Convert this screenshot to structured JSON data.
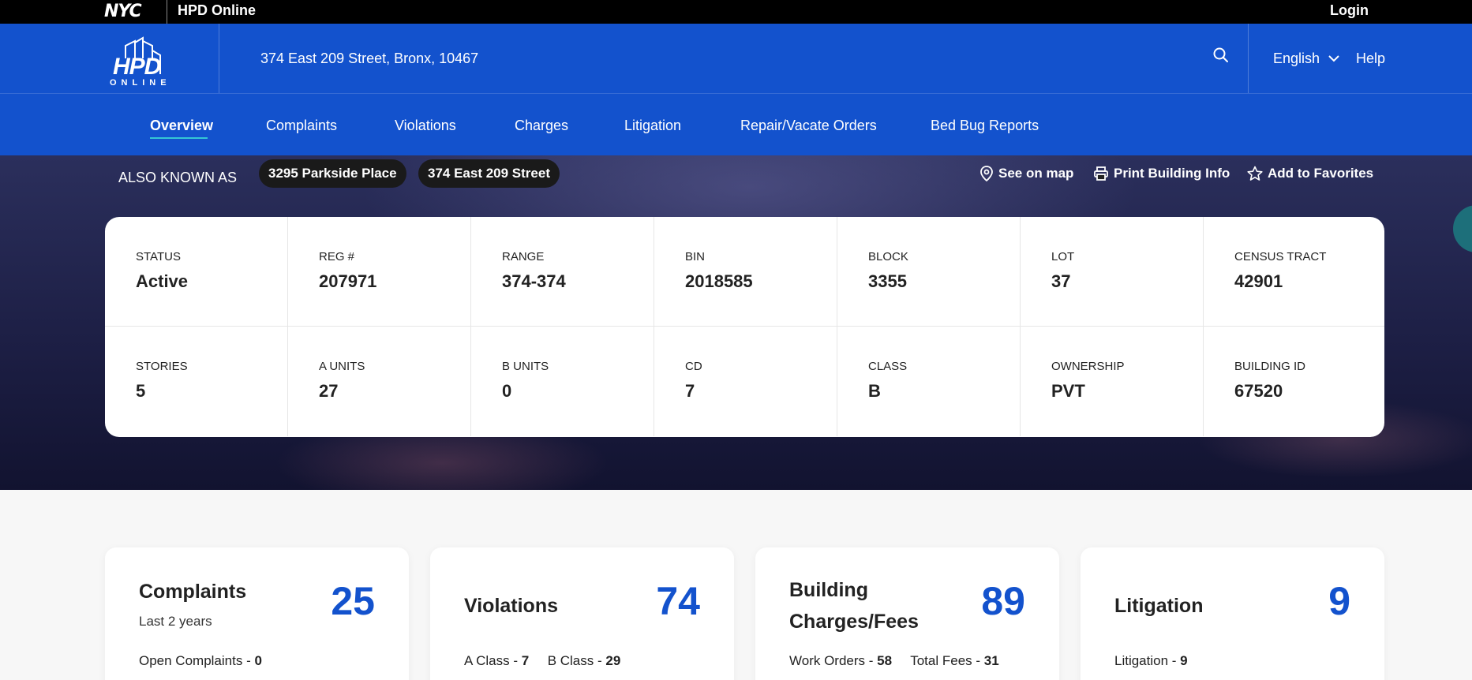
{
  "topbar": {
    "brand": "NYC",
    "app_title": "HPD Online",
    "login_label": "Login"
  },
  "header": {
    "logo_text": "HPD",
    "logo_subtext": "ONLINE",
    "address": "374 East 209 Street, Bronx, 10467",
    "language": "English",
    "help_label": "Help"
  },
  "nav": {
    "items": [
      {
        "label": "Overview",
        "active": true
      },
      {
        "label": "Complaints"
      },
      {
        "label": "Violations"
      },
      {
        "label": "Charges"
      },
      {
        "label": "Litigation"
      },
      {
        "label": "Repair/Vacate Orders"
      },
      {
        "label": "Bed Bug Reports"
      }
    ]
  },
  "hero": {
    "aka_label": "ALSO KNOWN AS",
    "aka": [
      "3295 Parkside Place",
      "374 East 209 Street"
    ],
    "actions": {
      "map": "See on map",
      "print": "Print Building Info",
      "favorites": "Add to Favorites"
    }
  },
  "building_info": {
    "row1": [
      {
        "label": "STATUS",
        "value": "Active"
      },
      {
        "label": "REG #",
        "value": "207971"
      },
      {
        "label": "RANGE",
        "value": "374-374"
      },
      {
        "label": "BIN",
        "value": "2018585"
      },
      {
        "label": "BLOCK",
        "value": "3355"
      },
      {
        "label": "LOT",
        "value": "37"
      },
      {
        "label": "CENSUS TRACT",
        "value": "42901"
      }
    ],
    "row2": [
      {
        "label": "STORIES",
        "value": "5"
      },
      {
        "label": "A UNITS",
        "value": "27"
      },
      {
        "label": "B UNITS",
        "value": "0"
      },
      {
        "label": "CD",
        "value": "7"
      },
      {
        "label": "CLASS",
        "value": "B"
      },
      {
        "label": "OWNERSHIP",
        "value": "PVT"
      },
      {
        "label": "BUILDING ID",
        "value": "67520"
      }
    ]
  },
  "summary": {
    "complaints": {
      "title": "Complaints",
      "subtitle": "Last 2 years",
      "count": "25",
      "stats": [
        {
          "label": "Open Complaints - ",
          "value": "0"
        }
      ]
    },
    "violations": {
      "title": "Violations",
      "count": "74",
      "stats": [
        {
          "label": "A Class - ",
          "value": "7"
        },
        {
          "label": "B Class - ",
          "value": "29"
        }
      ]
    },
    "charges": {
      "title_line1": "Building",
      "title_line2": "Charges/Fees",
      "count": "89",
      "stats": [
        {
          "label": "Work Orders - ",
          "value": "58"
        },
        {
          "label": "Total Fees - ",
          "value": "31"
        }
      ]
    },
    "litigation": {
      "title": "Litigation",
      "count": "9",
      "stats": [
        {
          "label": "Litigation - ",
          "value": "9"
        }
      ]
    }
  },
  "colors": {
    "brand_blue": "#1352cd",
    "accent_teal": "#35c6d5",
    "top_bar": "#000000"
  }
}
